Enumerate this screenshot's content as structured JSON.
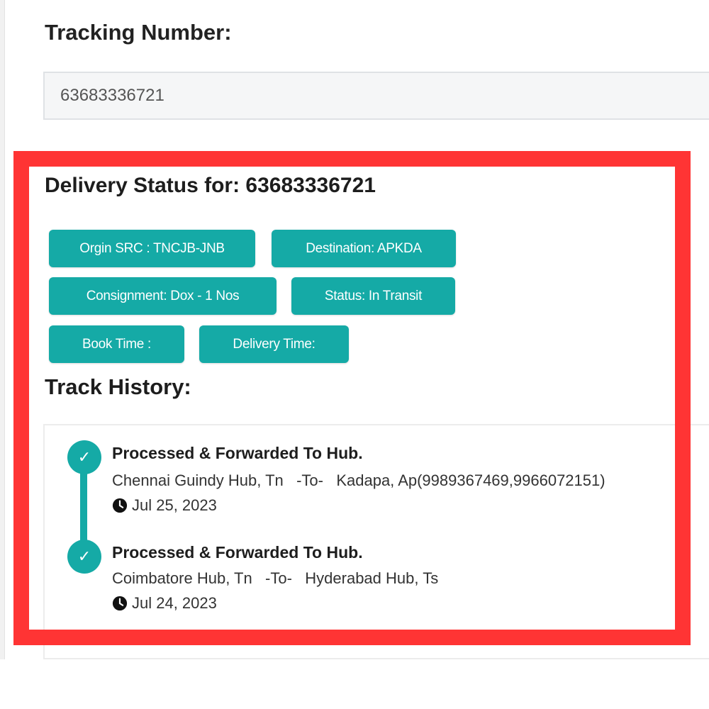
{
  "form": {
    "tracking_label": "Tracking Number:",
    "tracking_value": "63683336721"
  },
  "status": {
    "heading": "Delivery Status for: 63683336721",
    "badges": [
      "Orgin SRC : TNCJB-JNB",
      "Destination: APKDA",
      "Consignment: Dox - 1 Nos",
      "Status: In Transit",
      "Book Time :",
      "Delivery Time:"
    ]
  },
  "history": {
    "heading": "Track History:",
    "events": [
      {
        "title": "Processed & Forwarded To Hub.",
        "from": "Chennai Guindy Hub, Tn",
        "separator": "-To-",
        "to": "Kadapa, Ap(9989367469,9966072151)",
        "date": "Jul 25, 2023"
      },
      {
        "title": "Processed & Forwarded To Hub.",
        "from": "Coimbatore Hub, Tn",
        "separator": "-To-",
        "to": "Hyderabad Hub, Ts",
        "date": "Jul 24, 2023"
      }
    ]
  },
  "colors": {
    "accent": "#15aaa6",
    "highlight": "#ff3434"
  },
  "icons": {
    "check": "check-icon",
    "clock": "clock-icon"
  }
}
